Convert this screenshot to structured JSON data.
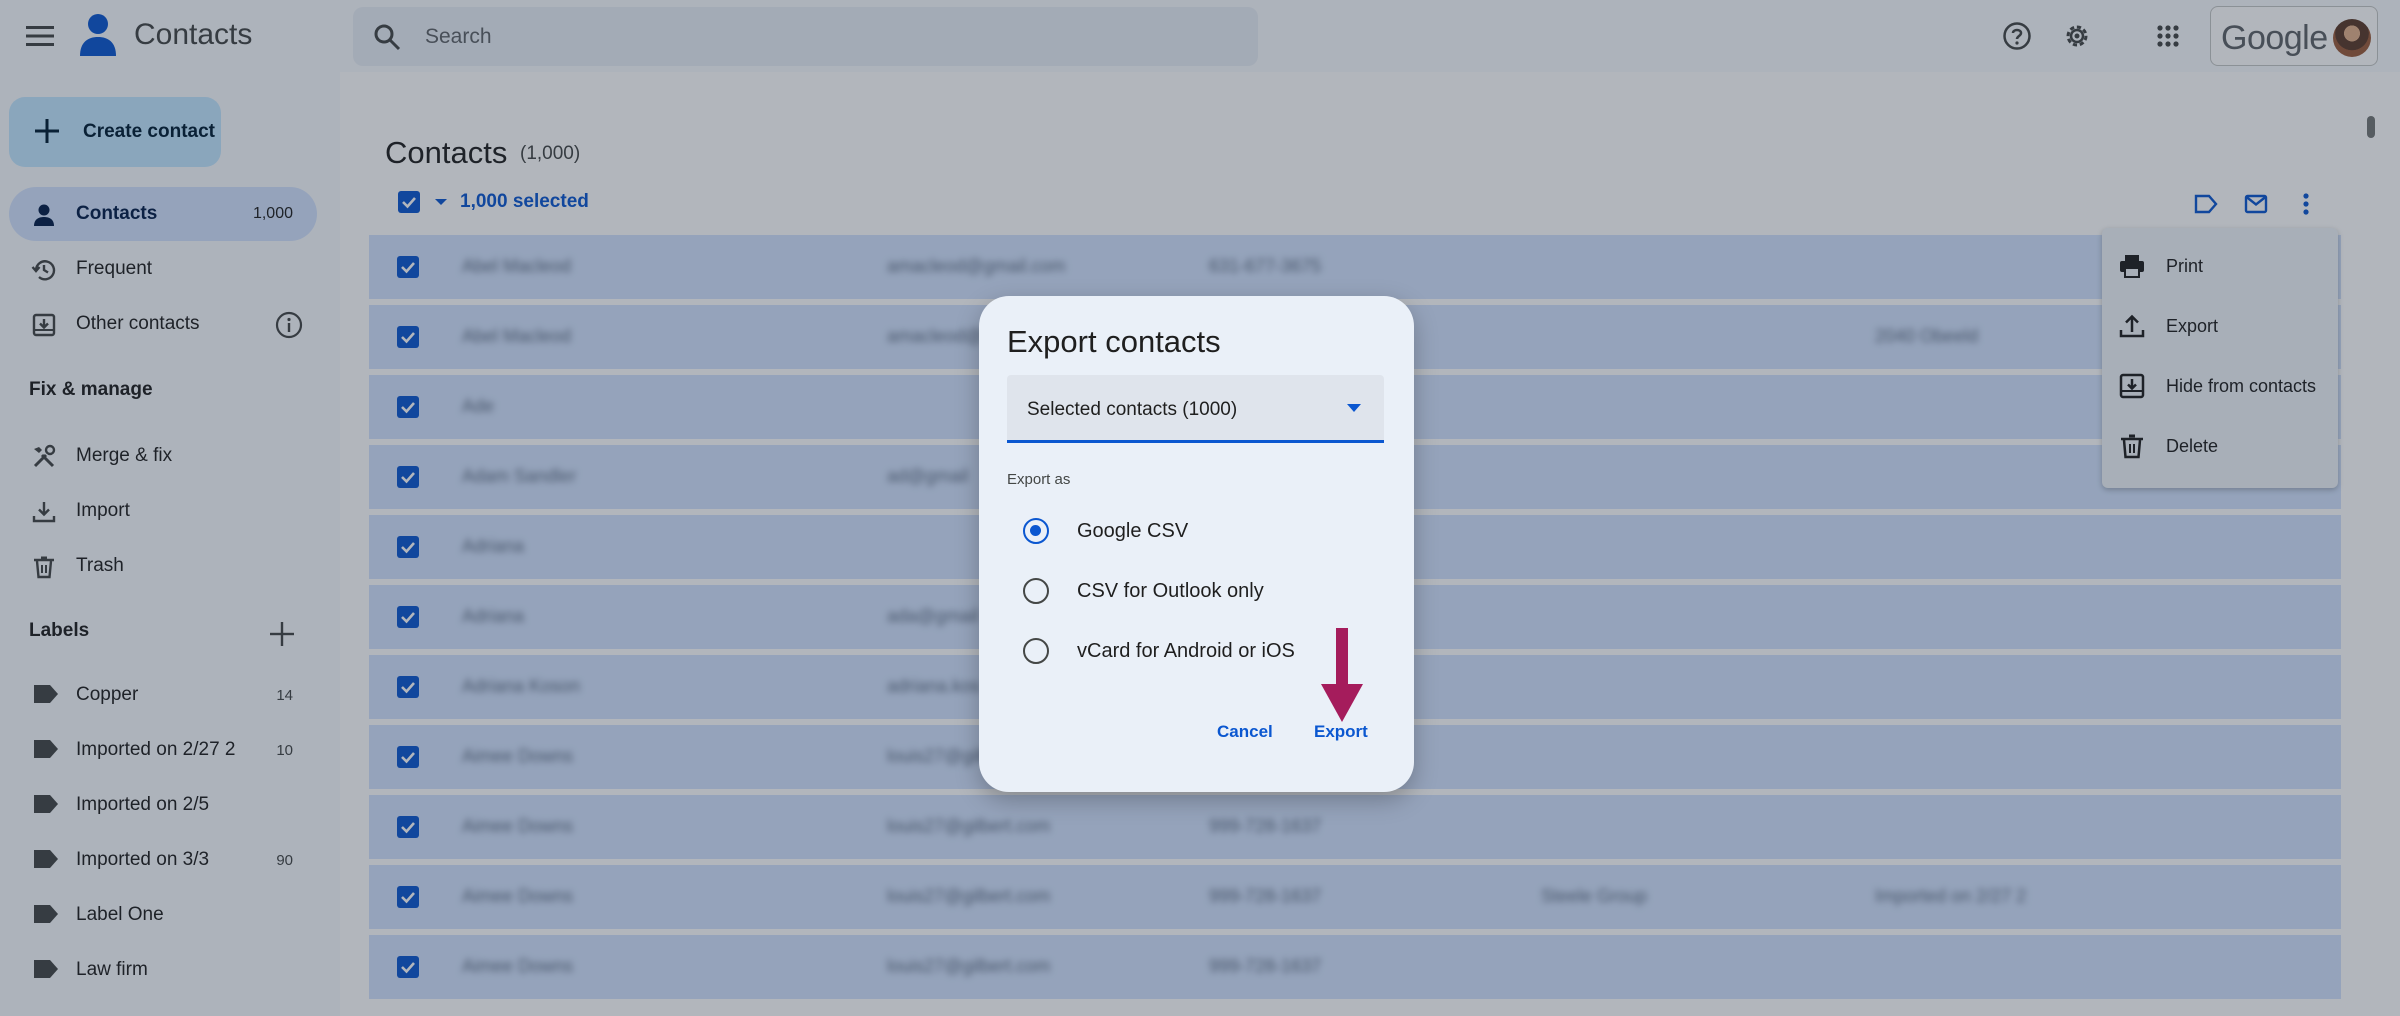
{
  "header": {
    "app_title": "Contacts",
    "search_placeholder": "Search",
    "account_brand": "Google"
  },
  "sidebar": {
    "create_label": "Create contact",
    "nav": [
      {
        "label": "Contacts",
        "count": "1,000",
        "active": true,
        "icon": "person-icon"
      },
      {
        "label": "Frequent",
        "count": "",
        "icon": "history-icon"
      },
      {
        "label": "Other contacts",
        "count": "",
        "icon": "download-box-icon"
      }
    ],
    "fix_manage_heading": "Fix & manage",
    "fix_items": [
      {
        "label": "Merge & fix",
        "icon": "tools-icon"
      },
      {
        "label": "Import",
        "icon": "import-icon"
      },
      {
        "label": "Trash",
        "icon": "trash-icon"
      }
    ],
    "labels_heading": "Labels",
    "labels": [
      {
        "label": "Copper",
        "count": "14"
      },
      {
        "label": "Imported on 2/27 2",
        "count": "10"
      },
      {
        "label": "Imported on 2/5",
        "count": ""
      },
      {
        "label": "Imported on 3/3",
        "count": "90"
      },
      {
        "label": "Label One",
        "count": ""
      },
      {
        "label": "Law firm",
        "count": ""
      }
    ]
  },
  "main": {
    "title": "Contacts",
    "count": "(1,000)",
    "selected_text": "1,000 selected",
    "rows": [
      {
        "name": "Abel Macleod",
        "email": "amacleod@gmail.com",
        "phone": "631-677-3675",
        "company": "",
        "label": ""
      },
      {
        "name": "Abel Macleod",
        "email": "amacleod@",
        "phone": "",
        "company": "",
        "label": "2040 Obeeld"
      },
      {
        "name": "Ade",
        "email": "",
        "phone": "",
        "company": "",
        "label": ""
      },
      {
        "name": "Adam Sandler",
        "email": "ad@gmail",
        "phone": "",
        "company": "",
        "label": ""
      },
      {
        "name": "Adriana",
        "email": "",
        "phone": "",
        "company": "",
        "label": ""
      },
      {
        "name": "Adriana",
        "email": "ada@gmail",
        "phone": "",
        "company": "",
        "label": ""
      },
      {
        "name": "Adriana Koson",
        "email": "adriana.kos",
        "phone": "",
        "company": "",
        "label": ""
      },
      {
        "name": "Aimee Downs",
        "email": "louis27@gilbert",
        "phone": "",
        "company": "",
        "label": ""
      },
      {
        "name": "Aimee Downs",
        "email": "louis27@gilbert.com",
        "phone": "999-728-1637",
        "company": "",
        "label": ""
      },
      {
        "name": "Aimee Downs",
        "email": "louis27@gilbert.com",
        "phone": "999-728-1637",
        "company": "Steele Group",
        "label": "Imported on 2/27 2"
      },
      {
        "name": "Aimee Downs",
        "email": "louis27@gilbert.com",
        "phone": "999-728-1637",
        "company": "",
        "label": ""
      }
    ]
  },
  "context_menu": {
    "items": [
      {
        "label": "Print",
        "icon": "print-icon"
      },
      {
        "label": "Export",
        "icon": "upload-icon"
      },
      {
        "label": "Hide from contacts",
        "icon": "hide-icon"
      },
      {
        "label": "Delete",
        "icon": "trash-icon"
      }
    ]
  },
  "dialog": {
    "title": "Export contacts",
    "select_value": "Selected contacts (1000)",
    "export_as_label": "Export as",
    "options": [
      {
        "label": "Google CSV",
        "selected": true
      },
      {
        "label": "CSV for Outlook only",
        "selected": false
      },
      {
        "label": "vCard for Android or iOS",
        "selected": false
      }
    ],
    "cancel_label": "Cancel",
    "export_label": "Export"
  },
  "colors": {
    "accent": "#0b57d0",
    "selected_row": "#d3e3fd",
    "annotation_arrow": "#a51c5c"
  }
}
